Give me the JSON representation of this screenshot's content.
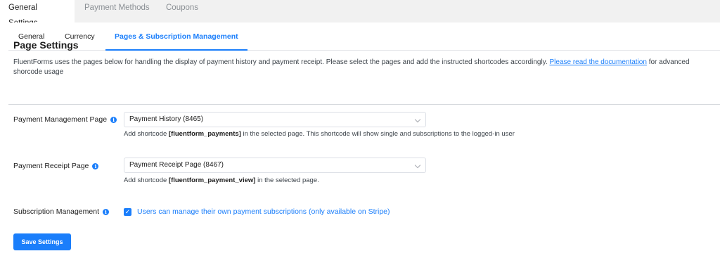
{
  "top_tabs": [
    "General Settings",
    "Payment Methods",
    "Coupons"
  ],
  "sub_tabs": [
    "General",
    "Currency",
    "Pages & Subscription Management"
  ],
  "page": {
    "title": "Page Settings",
    "description_before": "FluentForms uses the pages below for handling the display of payment history and payment receipt. Please select the pages and add the instructed shortcodes accordingly. ",
    "doc_link": "Please read the documentation",
    "description_after": " for advanced shorcode usage"
  },
  "payment_management": {
    "label": "Payment Management Page",
    "selected": "Payment History (8465)",
    "hint_before": "Add shortcode ",
    "shortcode": "[fluentform_payments]",
    "hint_after": " in the selected page. This shortcode will show single and subscriptions to the logged-in user"
  },
  "payment_receipt": {
    "label": "Payment Receipt Page",
    "selected": "Payment Receipt Page (8467)",
    "hint_before": "Add shortcode ",
    "shortcode": "[fluentform_payment_view]",
    "hint_after": " in the selected page."
  },
  "subscription": {
    "label": "Subscription Management",
    "checked": true,
    "checkbox_label": "Users can manage their own payment subscriptions (only available on Stripe)"
  },
  "save_button": "Save Settings",
  "icons": {
    "info": "info-icon",
    "select_arrow": "chevron-down-icon",
    "check": "checkmark-icon"
  },
  "colors": {
    "accent": "#1a7efb",
    "background": "#f1f1f1",
    "panel": "#ffffff"
  }
}
